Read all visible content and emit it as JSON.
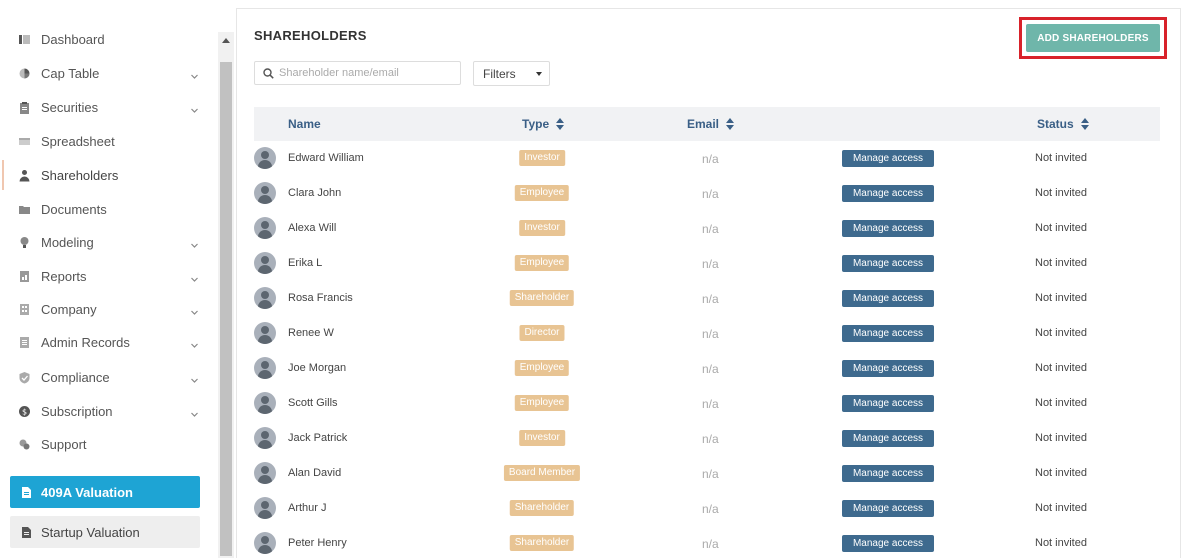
{
  "sidebar": {
    "items": [
      {
        "label": "Dashboard",
        "icon": "dashboard-icon",
        "chevron": false
      },
      {
        "label": "Cap Table",
        "icon": "pie-chart-icon",
        "chevron": true
      },
      {
        "label": "Securities",
        "icon": "clipboard-icon",
        "chevron": true
      },
      {
        "label": "Spreadsheet",
        "icon": "spreadsheet-icon",
        "chevron": false
      },
      {
        "label": "Shareholders",
        "icon": "user-icon",
        "chevron": false,
        "active": true
      },
      {
        "label": "Documents",
        "icon": "folder-icon",
        "chevron": false
      },
      {
        "label": "Modeling",
        "icon": "lightbulb-icon",
        "chevron": true
      },
      {
        "label": "Reports",
        "icon": "report-icon",
        "chevron": true
      },
      {
        "label": "Company",
        "icon": "building-icon",
        "chevron": true
      },
      {
        "label": "Admin Records",
        "icon": "records-icon",
        "chevron": true
      },
      {
        "label": "Compliance",
        "icon": "shield-check-icon",
        "chevron": true
      },
      {
        "label": "Subscription",
        "icon": "dollar-icon",
        "chevron": true
      },
      {
        "label": "Support",
        "icon": "support-icon",
        "chevron": false
      }
    ],
    "valuation_409a": "409A Valuation",
    "valuation_startup": "Startup Valuation"
  },
  "main": {
    "title": "SHAREHOLDERS",
    "add_button": "ADD SHAREHOLDERS",
    "search_placeholder": "Shareholder name/email",
    "filters_label": "Filters",
    "columns": {
      "name": "Name",
      "type": "Type",
      "email": "Email",
      "status": "Status"
    },
    "manage_label": "Manage access",
    "rows": [
      {
        "name": "Edward William",
        "type": "Investor",
        "email": "n/a",
        "status": "Not invited"
      },
      {
        "name": "Clara John",
        "type": "Employee",
        "email": "n/a",
        "status": "Not invited"
      },
      {
        "name": "Alexa Will",
        "type": "Investor",
        "email": "n/a",
        "status": "Not invited"
      },
      {
        "name": "Erika L",
        "type": "Employee",
        "email": "n/a",
        "status": "Not invited"
      },
      {
        "name": "Rosa Francis",
        "type": "Shareholder",
        "email": "n/a",
        "status": "Not invited"
      },
      {
        "name": "Renee W",
        "type": "Director",
        "email": "n/a",
        "status": "Not invited"
      },
      {
        "name": "Joe Morgan",
        "type": "Employee",
        "email": "n/a",
        "status": "Not invited"
      },
      {
        "name": "Scott Gills",
        "type": "Employee",
        "email": "n/a",
        "status": "Not invited"
      },
      {
        "name": "Jack Patrick",
        "type": "Investor",
        "email": "n/a",
        "status": "Not invited"
      },
      {
        "name": "Alan David",
        "type": "Board Member",
        "email": "n/a",
        "status": "Not invited"
      },
      {
        "name": "Arthur J",
        "type": "Shareholder",
        "email": "n/a",
        "status": "Not invited"
      },
      {
        "name": "Peter Henry",
        "type": "Shareholder",
        "email": "n/a",
        "status": "Not invited"
      }
    ]
  },
  "colors": {
    "accent_409a": "#1ea4d4",
    "add_button": "#6fb6aa",
    "highlight_outline": "#d8222a",
    "type_badge": "#e8c493",
    "manage_button": "#3e6a8e",
    "header_text": "#3a5f86"
  }
}
